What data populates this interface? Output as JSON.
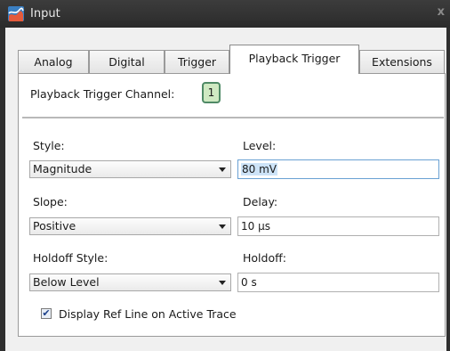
{
  "window": {
    "title": "Input",
    "close_glyph": "x"
  },
  "tabs": [
    {
      "label": "Analog"
    },
    {
      "label": "Digital"
    },
    {
      "label": "Trigger"
    },
    {
      "label": "Playback Trigger",
      "active": true
    },
    {
      "label": "Extensions"
    }
  ],
  "channel": {
    "label": "Playback Trigger Channel:",
    "value": "1"
  },
  "form": {
    "style": {
      "label": "Style:",
      "value": "Magnitude"
    },
    "level": {
      "label": "Level:",
      "value": "80 mV"
    },
    "slope": {
      "label": "Slope:",
      "value": "Positive"
    },
    "delay": {
      "label": "Delay:",
      "value": "10 µs"
    },
    "holdoff_style": {
      "label": "Holdoff Style:",
      "value": "Below Level"
    },
    "holdoff": {
      "label": "Holdoff:",
      "value": "0 s"
    }
  },
  "checkbox": {
    "label": "Display Ref Line on Active Trace",
    "checked": true
  },
  "colors": {
    "titlebar": "#2f2f2f",
    "channel_badge_fill": "#cfe9c2",
    "channel_badge_border": "#4f8a66",
    "focus_border": "#6aa1d3"
  }
}
